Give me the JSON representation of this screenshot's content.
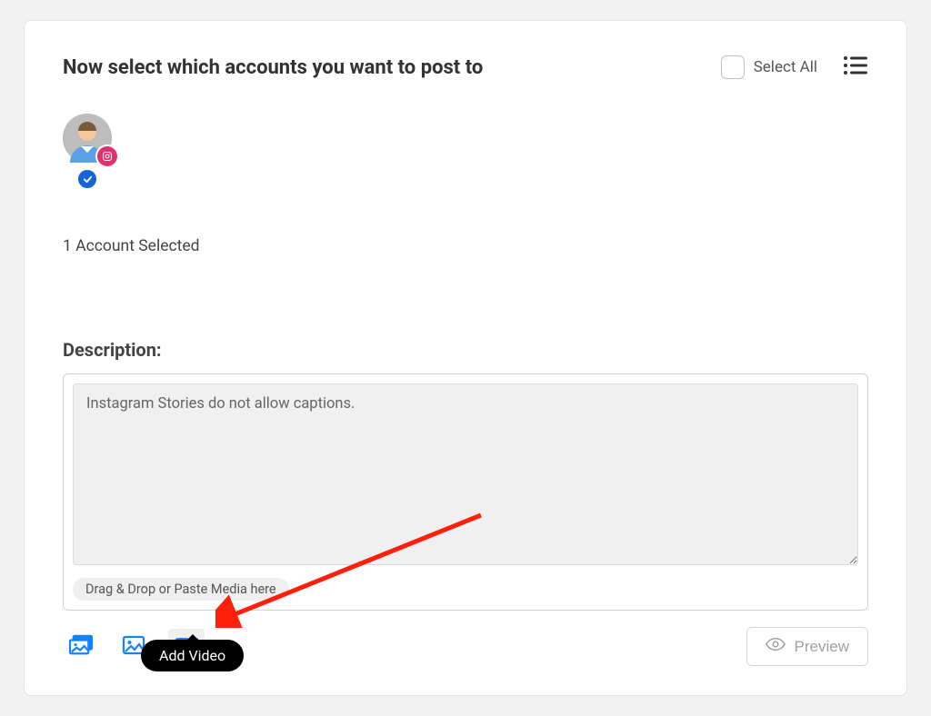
{
  "header": {
    "title": "Now select which accounts you want to post to",
    "select_all_label": "Select All"
  },
  "accounts": {
    "selected_count_text": "1 Account Selected"
  },
  "description": {
    "label": "Description:",
    "placeholder": "Instagram Stories do not allow captions.",
    "drag_hint": "Drag & Drop or Paste Media here"
  },
  "toolbar": {
    "preview_label": "Preview",
    "tooltip_add_video": "Add Video"
  },
  "icons": {
    "list_toggle": "list-icon",
    "platform": "instagram-icon",
    "check": "check-icon",
    "gallery": "gallery-icon",
    "image": "image-icon",
    "video": "video-icon",
    "eye": "eye-icon"
  },
  "colors": {
    "accent_blue": "#1183ff",
    "instagram": "#e1306c",
    "selected_blue": "#1565d8",
    "arrow_red": "#ff1f0a"
  }
}
